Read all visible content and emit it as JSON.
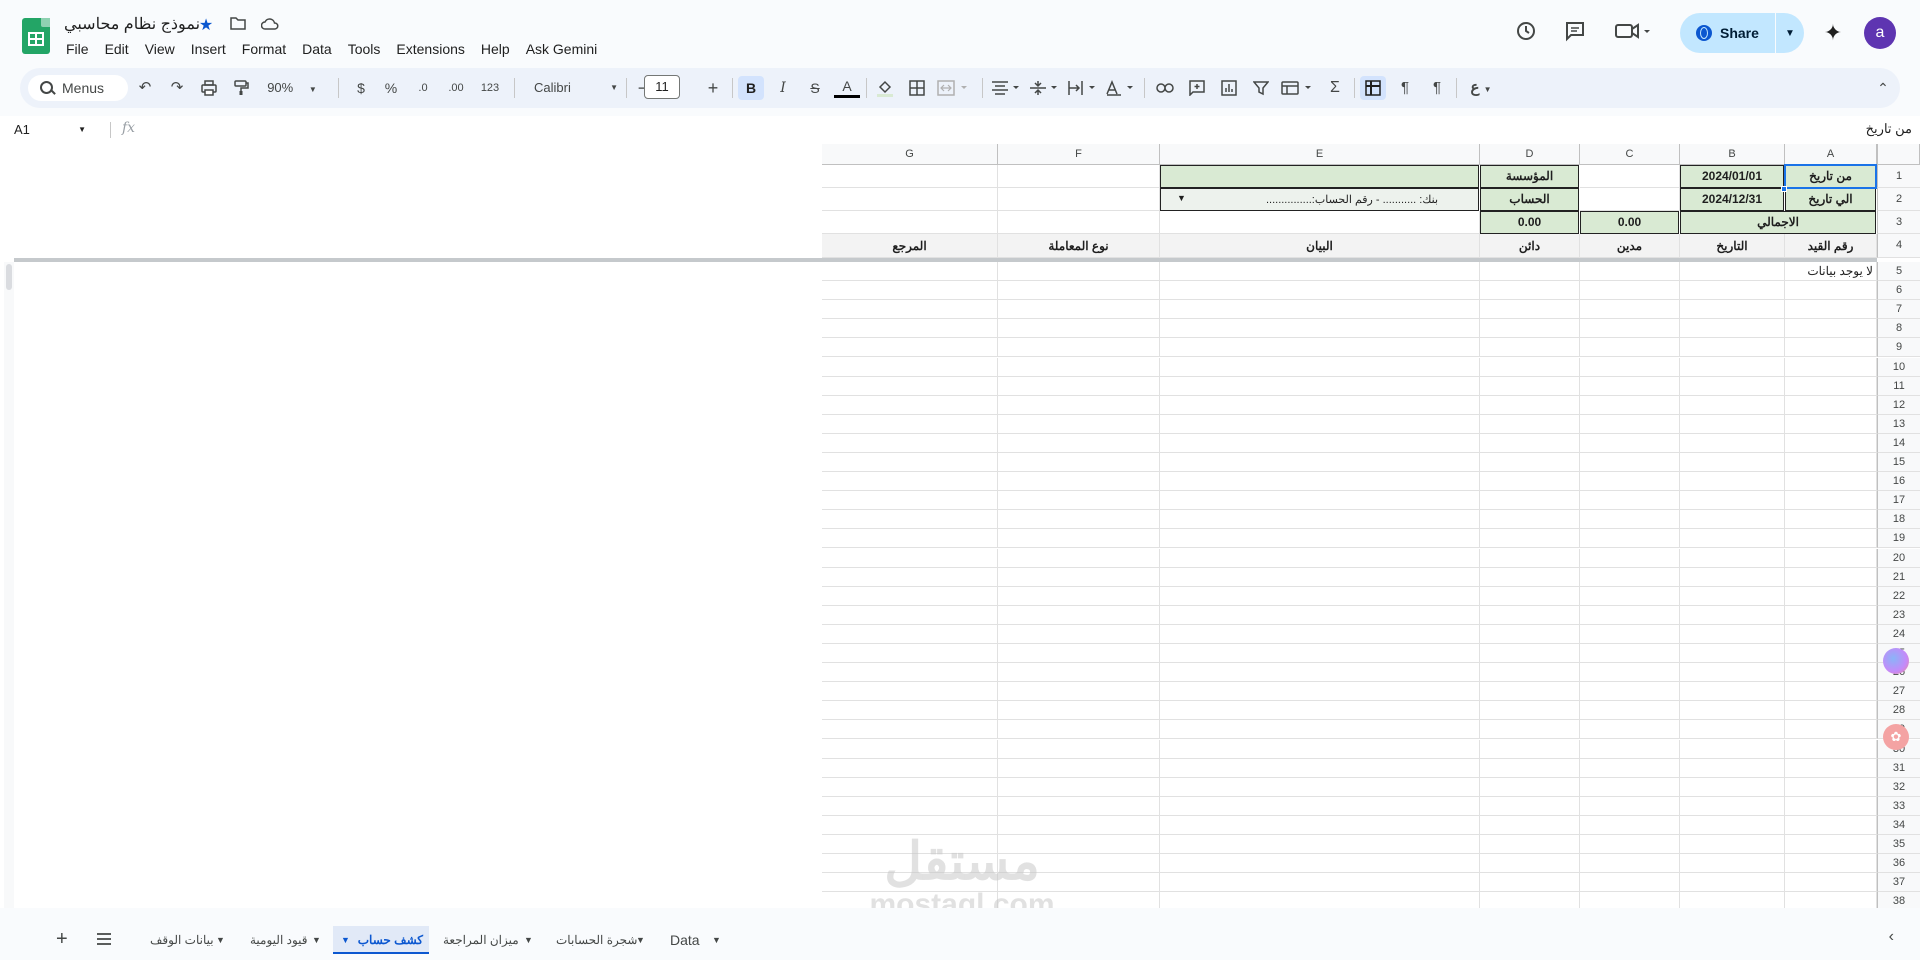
{
  "document": {
    "title": "نموذج نظام محاسبي"
  },
  "menu": [
    "File",
    "Edit",
    "View",
    "Insert",
    "Format",
    "Data",
    "Tools",
    "Extensions",
    "Help",
    "Ask Gemini"
  ],
  "header": {
    "share_label": "Share",
    "avatar_letter": "a"
  },
  "toolbar": {
    "search_label": "Menus",
    "zoom": "90%",
    "currency": "$",
    "percent": "%",
    "dec_minus": ".0",
    "dec_plus": ".00",
    "format_123": "123",
    "font": "Calibri",
    "font_size": "11"
  },
  "formula_bar": {
    "name_box": "A1",
    "value": "من تاريخ"
  },
  "columns": [
    "A",
    "B",
    "C",
    "D",
    "E",
    "F",
    "G"
  ],
  "cells": {
    "a1": "من تاريخ",
    "b1": "2024/01/01",
    "d1": "المؤسسة",
    "a2": "الي تاريخ",
    "b2": "2024/12/31",
    "d2": "الحساب",
    "e2": "بنك: ........... - رقم الحساب:...............",
    "ab3": "الاجمالي",
    "c3": "0.00",
    "d3": "0.00",
    "h_a": "رقم القيد",
    "h_b": "التاريخ",
    "h_c": "مدين",
    "h_d": "دائن",
    "h_e": "البيان",
    "h_f": "نوع المعاملة",
    "h_g": "المرجع",
    "a5": "لا يوجد بيانات"
  },
  "rows": [
    "1",
    "2",
    "3",
    "4",
    "5",
    "6",
    "7",
    "8",
    "9",
    "10",
    "11",
    "12",
    "13",
    "14",
    "15",
    "16",
    "17",
    "18",
    "19",
    "20",
    "21",
    "22",
    "23",
    "24",
    "25",
    "26",
    "27",
    "28",
    "29",
    "30",
    "31",
    "32",
    "33",
    "34",
    "35",
    "36",
    "37",
    "38"
  ],
  "sheet_tabs": [
    "بيانات الوقف",
    "قيود اليومية",
    "كشف حساب",
    "ميزان المراجعة",
    "شجرة الحسابات",
    "Data"
  ],
  "active_tab": "كشف حساب",
  "watermark": {
    "arabic": "مستقل",
    "latin": "mostaql.com"
  },
  "colors": {
    "accent": "#0b57d0",
    "cell_fill": "#d9ead3",
    "share_bg": "#c2e7ff",
    "avatar": "#5e35b1"
  }
}
